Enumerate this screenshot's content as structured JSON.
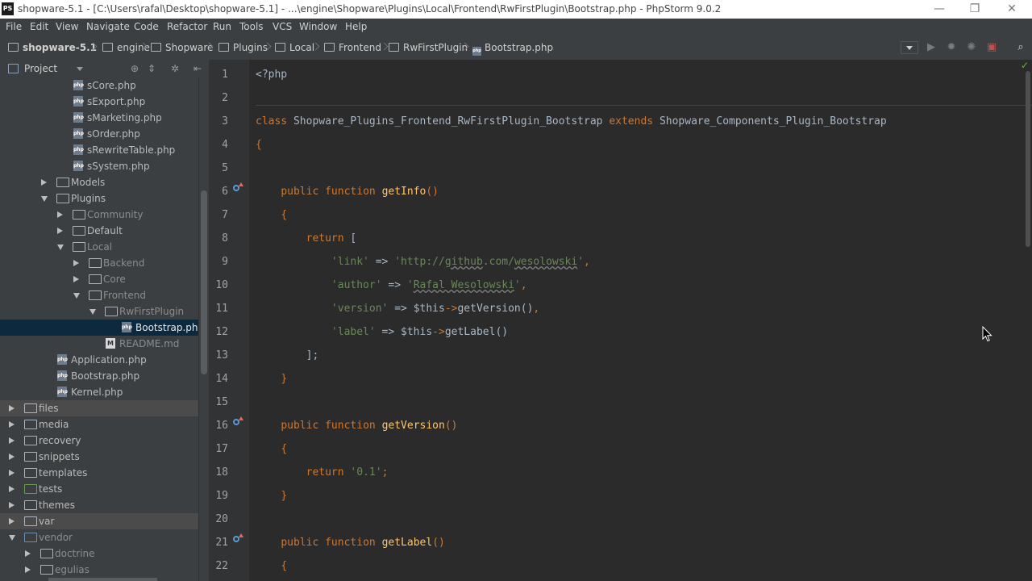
{
  "window": {
    "title": "shopware-5.1 - [C:\\Users\\rafal\\Desktop\\shopware-5.1] - ...\\engine\\Shopware\\Plugins\\Local\\Frontend\\RwFirstPlugin\\Bootstrap.php - PhpStorm 9.0.2",
    "app_icon": "PS",
    "controls": {
      "minimize": "—",
      "maximize": "❐",
      "close": "✕"
    }
  },
  "menu": [
    "File",
    "Edit",
    "View",
    "Navigate",
    "Code",
    "Refactor",
    "Run",
    "Tools",
    "VCS",
    "Window",
    "Help"
  ],
  "breadcrumbs": [
    "shopware-5.1",
    "engine",
    "Shopware",
    "Plugins",
    "Local",
    "Frontend",
    "RwFirstPlugin",
    "Bootstrap.php"
  ],
  "project_panel": {
    "label": "Project",
    "tree": [
      {
        "label": "sCore.php",
        "type": "php"
      },
      {
        "label": "sExport.php",
        "type": "php"
      },
      {
        "label": "sMarketing.php",
        "type": "php"
      },
      {
        "label": "sOrder.php",
        "type": "php"
      },
      {
        "label": "sRewriteTable.php",
        "type": "php"
      },
      {
        "label": "sSystem.php",
        "type": "php"
      },
      {
        "label": "Models",
        "type": "folder"
      },
      {
        "label": "Plugins",
        "type": "folder"
      },
      {
        "label": "Community",
        "type": "folder"
      },
      {
        "label": "Default",
        "type": "folder"
      },
      {
        "label": "Local",
        "type": "folder"
      },
      {
        "label": "Backend",
        "type": "folder"
      },
      {
        "label": "Core",
        "type": "folder"
      },
      {
        "label": "Frontend",
        "type": "folder"
      },
      {
        "label": "RwFirstPlugin",
        "type": "folder"
      },
      {
        "label": "Bootstrap.php",
        "type": "php"
      },
      {
        "label": "README.md",
        "type": "md"
      },
      {
        "label": "Application.php",
        "type": "php"
      },
      {
        "label": "Bootstrap.php",
        "type": "php"
      },
      {
        "label": "Kernel.php",
        "type": "php"
      },
      {
        "label": "files",
        "type": "folder"
      },
      {
        "label": "media",
        "type": "folder"
      },
      {
        "label": "recovery",
        "type": "folder"
      },
      {
        "label": "snippets",
        "type": "folder"
      },
      {
        "label": "templates",
        "type": "folder"
      },
      {
        "label": "tests",
        "type": "folder"
      },
      {
        "label": "themes",
        "type": "folder"
      },
      {
        "label": "var",
        "type": "folder"
      },
      {
        "label": "vendor",
        "type": "folder"
      },
      {
        "label": "doctrine",
        "type": "folder"
      },
      {
        "label": "egulias",
        "type": "folder"
      }
    ]
  },
  "editor": {
    "line_numbers": [
      "1",
      "2",
      "3",
      "4",
      "5",
      "6",
      "7",
      "8",
      "9",
      "10",
      "11",
      "12",
      "13",
      "14",
      "15",
      "16",
      "17",
      "18",
      "19",
      "20",
      "21",
      "22"
    ],
    "tokens": {
      "php_open": "<?php",
      "class_kw": "class",
      "class_name": "Shopware_Plugins_Frontend_RwFirstPlugin_Bootstrap",
      "extends_kw": "extends",
      "parent_class": "Shopware_Components_Plugin_Bootstrap",
      "lbrace": "{",
      "rbrace": "}",
      "public_kw": "public",
      "function_kw": "function",
      "fn_getinfo": "getInfo",
      "fn_getversion": "getVersion",
      "fn_getlabel": "getLabel",
      "parens": "()",
      "return_kw": "return",
      "lbracket": "[",
      "rbracket_semicolon": "];",
      "arrow": "=>",
      "comma": ",",
      "this_var": "$this",
      "obj_op": "->",
      "call_getversion": "getVersion()",
      "call_getlabel": "getLabel()",
      "key_link": "'link'",
      "val_link_a": "'http://",
      "val_link_b": "github",
      "val_link_c": ".com/",
      "val_link_d": "wesolowski",
      "val_link_e": "'",
      "key_author": "'author'",
      "val_author_a": "'",
      "val_author_b": "Rafal Wesolowski",
      "val_author_c": "'",
      "key_version": "'version'",
      "key_label": "'label'",
      "val_version": "'0.1'",
      "semicolon": ";"
    }
  }
}
